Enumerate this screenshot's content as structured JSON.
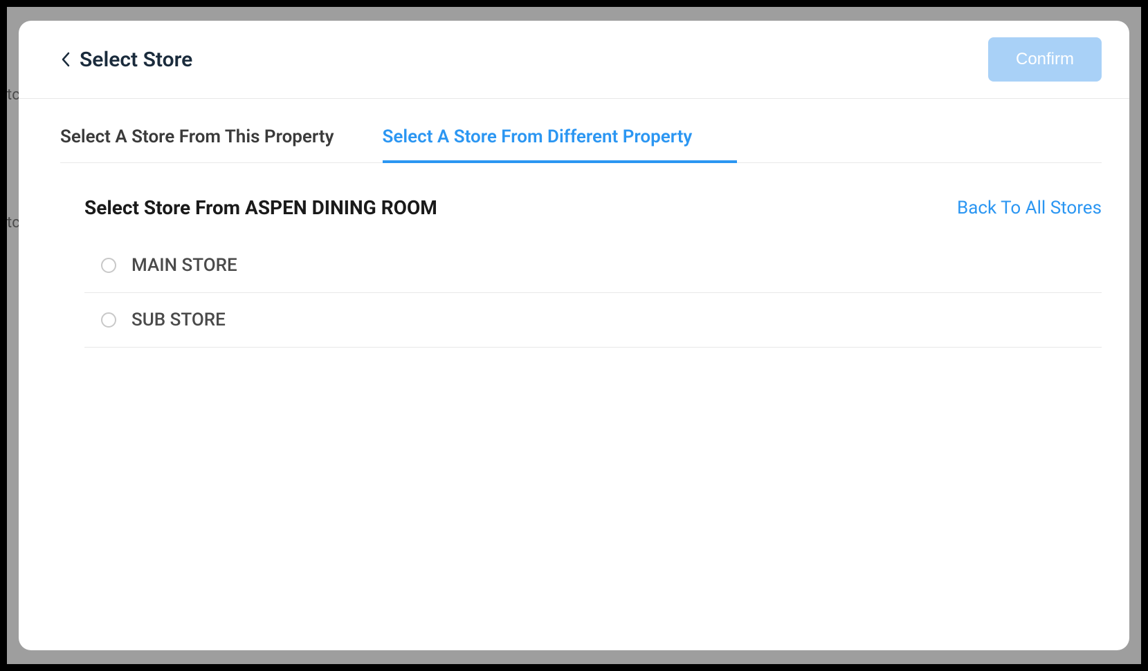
{
  "backdrop": {
    "fragment1": "tc",
    "fragment2": "tc"
  },
  "header": {
    "title": "Select Store",
    "confirm_label": "Confirm"
  },
  "tabs": [
    {
      "label": "Select A Store From This Property",
      "active": false
    },
    {
      "label": "Select A Store From Different Property",
      "active": true
    }
  ],
  "content": {
    "title": "Select Store From ASPEN DINING ROOM",
    "back_link": "Back To All Stores",
    "stores": [
      {
        "name": "MAIN STORE",
        "selected": false
      },
      {
        "name": "SUB STORE",
        "selected": false
      }
    ]
  }
}
